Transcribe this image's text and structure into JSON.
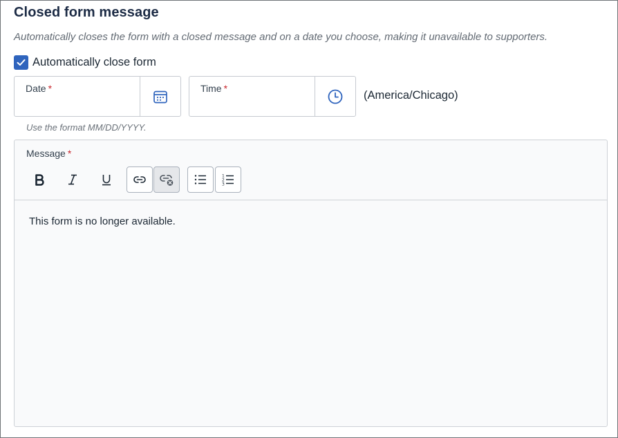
{
  "section": {
    "title": "Closed form message",
    "description": "Automatically closes the form with a closed message and on a date you choose, making it unavailable to supporters."
  },
  "auto_close": {
    "label": "Automatically close form",
    "checked": true
  },
  "date_field": {
    "label": "Date",
    "required_mark": "*",
    "value": "",
    "button_icon": "calendar-icon"
  },
  "time_field": {
    "label": "Time",
    "required_mark": "*",
    "value": "",
    "button_icon": "clock-icon"
  },
  "timezone": "(America/Chicago)",
  "date_hint": "Use the format MM/DD/YYYY.",
  "message_editor": {
    "label": "Message",
    "required_mark": "*",
    "toolbar": [
      "bold-icon",
      "italic-icon",
      "underline-icon",
      "link-icon",
      "unlink-icon",
      "bulleted-list-icon",
      "numbered-list-icon"
    ],
    "content": "This form is no longer available."
  },
  "colors": {
    "accent": "#2f64bd",
    "title": "#1c2b45",
    "required": "#c8262d",
    "icon_blue": "#2f64bd"
  }
}
